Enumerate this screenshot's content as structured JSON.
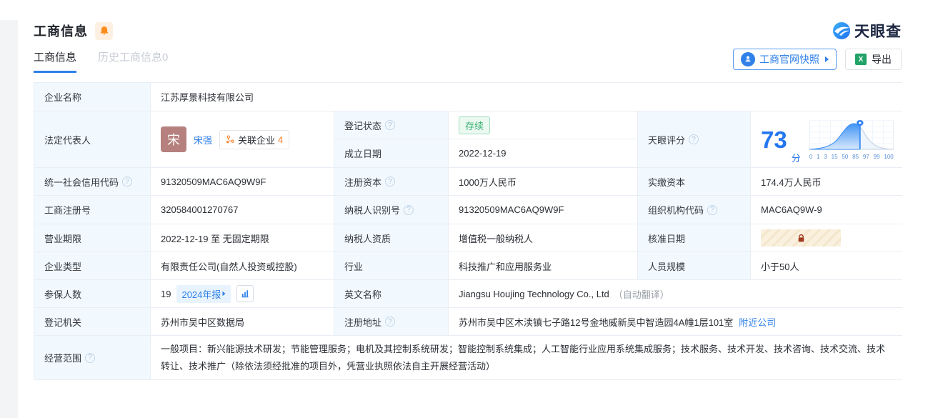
{
  "header": {
    "title": "工商信息",
    "logo_text": "天眼查"
  },
  "tabs": {
    "current": "工商信息",
    "history": "历史工商信息0"
  },
  "toolbar": {
    "snapshot_label": "工商官网快照",
    "export_label": "导出"
  },
  "icons": {
    "bell": "bell-icon (orange, subscribe/monitor)",
    "help": "question-circle-icon",
    "stamp": "official-seal-icon",
    "excel": "excel-export-icon",
    "network": "related-company-icon (orange)",
    "trend": "annual-report-chart-icon (blue)",
    "lock": "lock-icon (dark red, hidden value)",
    "pin": "score-marker-pin-icon"
  },
  "colors": {
    "accent_blue": "#2f80e8",
    "score_blue": "#2477f0",
    "status_green": "#3bb273",
    "status_green_bg": "#ebf9f1",
    "orange": "#f7802b",
    "bell_orange": "#ff8c1a",
    "avatar_bg": "#b5807d",
    "label_bg": "#f2f9fe",
    "grid_border": "#e9eef5",
    "lock_red": "#a03a20"
  },
  "fields": {
    "company_name": {
      "label": "企业名称",
      "value": "江苏厚景科技有限公司"
    },
    "legal_rep": {
      "label": "法定代表人",
      "avatar_char": "宋",
      "name": "宋强",
      "related_label": "关联企业",
      "related_count": "4"
    },
    "reg_status": {
      "label": "登记状态",
      "value": "存续"
    },
    "establish_date": {
      "label": "成立日期",
      "value": "2022-12-19"
    },
    "tyc_score": {
      "label": "天眼评分",
      "value": "73",
      "unit": "分"
    },
    "credit_code": {
      "label": "统一社会信用代码",
      "value": "91320509MAC6AQ9W9F"
    },
    "reg_capital": {
      "label": "注册资本",
      "value": "1000万人民币"
    },
    "paid_capital": {
      "label": "实缴资本",
      "value": "174.4万人民币"
    },
    "reg_number": {
      "label": "工商注册号",
      "value": "320584001270767"
    },
    "taxpayer_id": {
      "label": "纳税人识别号",
      "value": "91320509MAC6AQ9W9F"
    },
    "org_code": {
      "label": "组织机构代码",
      "value": "MAC6AQ9W-9"
    },
    "business_term": {
      "label": "营业期限",
      "value": "2022-12-19 至 无固定期限"
    },
    "taxpayer_quality": {
      "label": "纳税人资质",
      "value": "增值税一般纳税人"
    },
    "approval_date": {
      "label": "核准日期",
      "value_hidden": true
    },
    "company_type": {
      "label": "企业类型",
      "value": "有限责任公司(自然人投资或控股)"
    },
    "industry": {
      "label": "行业",
      "value": "科技推广和应用服务业"
    },
    "staff_size": {
      "label": "人员规模",
      "value": "小于50人"
    },
    "insured_count": {
      "label": "参保人数",
      "value": "19",
      "report_badge": "2024年报"
    },
    "english_name": {
      "label": "英文名称",
      "value": "Jiangsu Houjing Technology Co., Ltd",
      "note": "（自动翻译）"
    },
    "reg_authority": {
      "label": "登记机关",
      "value": "苏州市吴中区数据局"
    },
    "reg_address": {
      "label": "注册地址",
      "value": "苏州市吴中区木渎镇七子路12号金地威新吴中智造园4A幢1层101室",
      "nearby_link": "附近公司"
    },
    "business_scope": {
      "label": "经营范围",
      "value": "一般项目：新兴能源技术研发；节能管理服务；电机及其控制系统研发；智能控制系统集成；人工智能行业应用系统集成服务；技术服务、技术开发、技术咨询、技术交流、技术转让、技术推广（除依法须经批准的项目外，凭营业执照依法自主开展经营活动）"
    }
  },
  "score_chart": {
    "type": "area",
    "title": "天眼评分分布曲线",
    "score": 73,
    "ticks": [
      "0",
      "1",
      "3",
      "15",
      "50",
      "85",
      "97",
      "99",
      "100"
    ],
    "marker_position_percent": 60,
    "filled_color": "#3f93f5",
    "rest_color": "#c3d2e3",
    "grid": true
  }
}
